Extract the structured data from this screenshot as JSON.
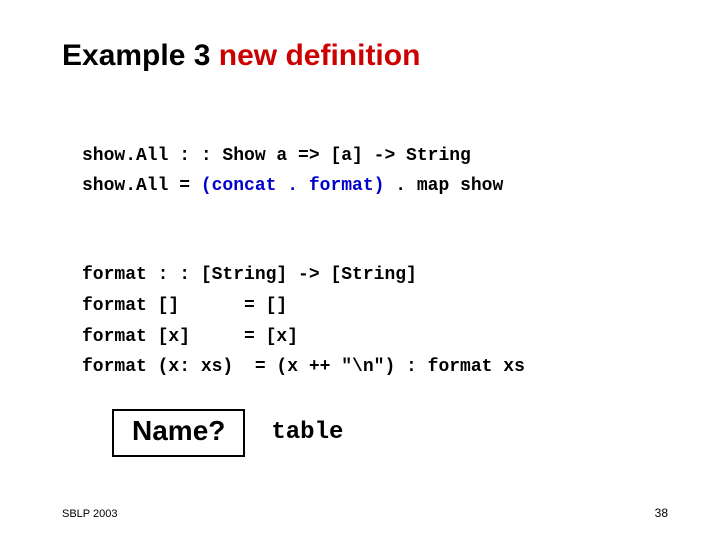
{
  "title": {
    "prefix": "Example 3 ",
    "highlight": "new definition"
  },
  "code": {
    "sig1": "show.All : : Show a => [a] -> String",
    "def1a": "show.All = ",
    "def1b": "(concat . format)",
    "def1c": " . map show",
    "sig2": "format : : [String] -> [String]",
    "def2": "format []      = []",
    "def3": "format [x]     = [x]",
    "def4": "format (x: xs)  = (x ++ \"\\n\") : format xs"
  },
  "question": "Name?",
  "answer": "table",
  "footer": {
    "left": "SBLP 2003",
    "right": "38"
  }
}
